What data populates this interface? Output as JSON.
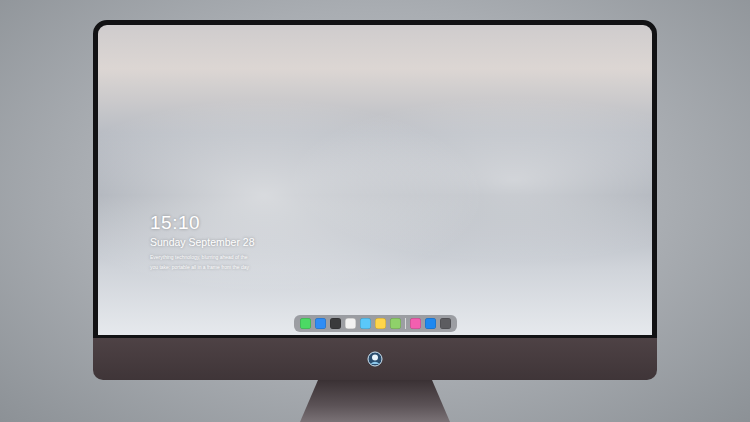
{
  "lock_screen": {
    "time": "15:10",
    "date": "Sunday September 28",
    "caption": [
      "Everything technology, blurring ahead of the",
      "you take: portable all in a frame from the day"
    ]
  },
  "dock": {
    "items": [
      {
        "kind": "app",
        "color": "#4cd964"
      },
      {
        "kind": "app",
        "color": "#2f8df5"
      },
      {
        "kind": "app",
        "color": "#3a3a3c"
      },
      {
        "kind": "app",
        "color": "#f2f2f2"
      },
      {
        "kind": "app",
        "color": "#5ac8fa"
      },
      {
        "kind": "app",
        "color": "#ffd54a"
      },
      {
        "kind": "app",
        "color": "#8fd16a"
      },
      {
        "kind": "divider"
      },
      {
        "kind": "app",
        "color": "#f35fb0"
      },
      {
        "kind": "app",
        "color": "#1e88f0"
      },
      {
        "kind": "app",
        "color": "#5c5c60"
      }
    ]
  }
}
